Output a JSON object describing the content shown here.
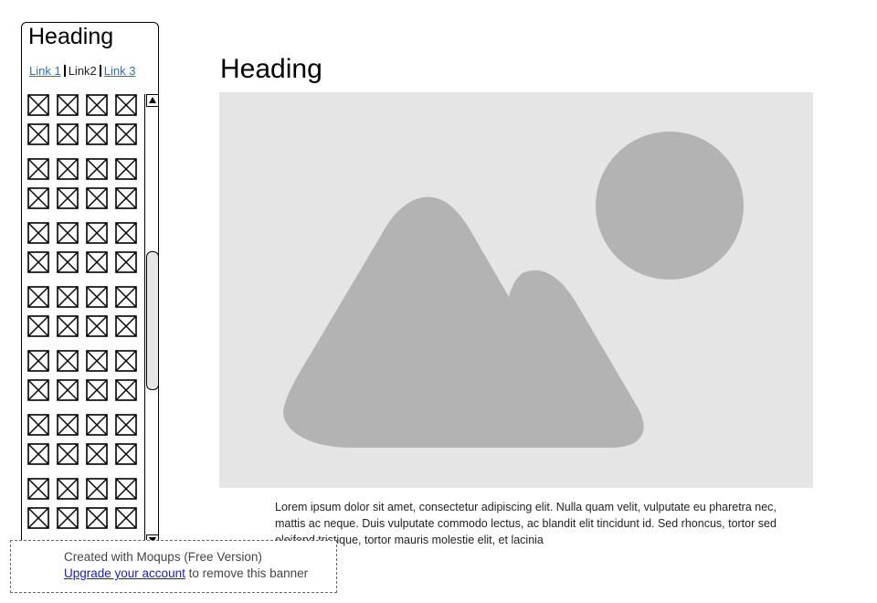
{
  "sidebar": {
    "heading": "Heading",
    "links": [
      {
        "label": "Link 1",
        "active": false
      },
      {
        "label": "Link2",
        "active": true
      },
      {
        "label": "Link 3",
        "active": false
      }
    ],
    "icon_grid": {
      "rows": 14,
      "cols": 4,
      "icon": "image-placeholder-icon"
    },
    "scrollbar": {
      "up_icon": "arrow-up-icon",
      "down_icon": "arrow-down-icon"
    }
  },
  "main": {
    "heading": "Heading",
    "image": {
      "icon": "image-placeholder-icon",
      "background": "#e5e5e5",
      "shape_color": "#b3b3b3"
    },
    "body_text": "Lorem ipsum dolor sit amet, consectetur adipiscing elit. Nulla quam velit, vulputate eu pharetra nec, mattis ac neque. Duis vulputate commodo lectus, ac blandit elit tincidunt id. Sed rhoncus, tortor sed eleifend tristique, tortor mauris molestie elit, et lacinia"
  },
  "banner": {
    "line1": "Created with Moqups (Free Version)",
    "link": "Upgrade your account",
    "suffix": " to remove this banner"
  }
}
